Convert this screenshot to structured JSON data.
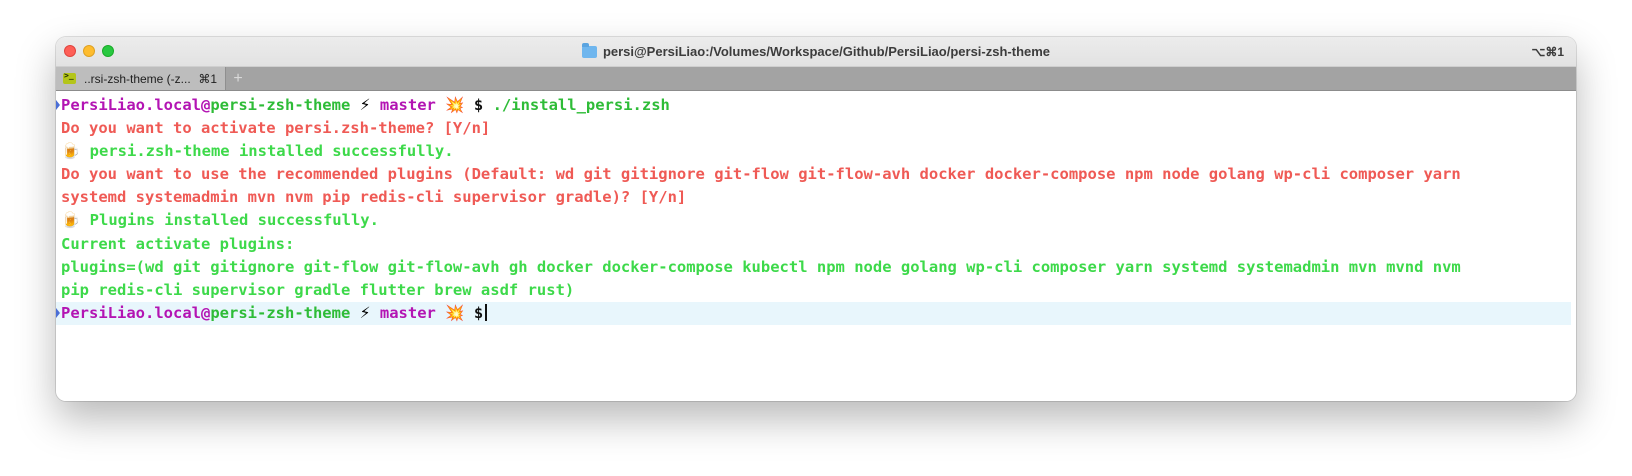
{
  "window": {
    "title": "persi@PersiLiao:/Volumes/Workspace/Github/PersiLiao/persi-zsh-theme",
    "shortcut": "⌥⌘1"
  },
  "tab": {
    "label": "..rsi-zsh-theme (-z...",
    "shortcut": "⌘1",
    "new_tab": "+"
  },
  "prompt": {
    "user_host": "PersiLiao.local",
    "at": "@",
    "dir": "persi-zsh-theme",
    "bolt": "⚡",
    "branch": "master",
    "burst": "💥",
    "dollar": "$"
  },
  "terminal": {
    "command": "./install_persi.zsh",
    "q1": "Do you want to activate persi.zsh-theme? [Y/n]",
    "beer": "🍺",
    "ok1": "persi.zsh-theme installed successfully.",
    "q2_line1": "Do you want to use the recommended plugins (Default: wd git gitignore git-flow git-flow-avh docker docker-compose npm node golang wp-cli composer yarn",
    "q2_line2": "systemd systemadmin mvn nvm pip redis-cli supervisor gradle)? [Y/n]",
    "ok2": "Plugins installed successfully.",
    "current_label": "Current activate plugins:",
    "plugins_line1": "plugins=(wd git gitignore git-flow git-flow-avh gh docker docker-compose kubectl npm node golang wp-cli composer yarn systemd systemadmin mvn mvnd nvm",
    "plugins_line2": "pip redis-cli supervisor gradle flutter brew asdf rust)"
  },
  "colors": {
    "prompt_magenta": "#b314b3",
    "prompt_green": "#2ebc37",
    "message_red": "#ef5a55",
    "message_green": "#3dd94a",
    "current_line_bg": "#e8f6fc"
  }
}
